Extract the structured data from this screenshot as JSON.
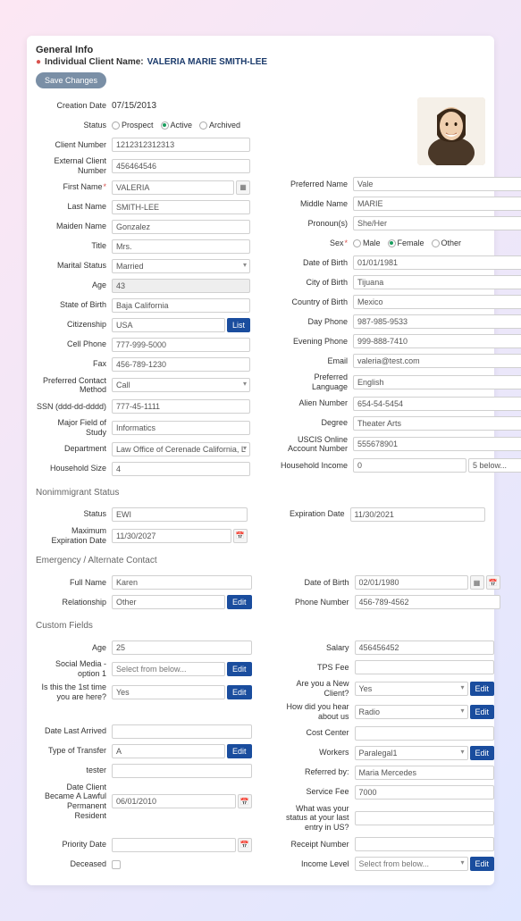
{
  "header": {
    "title": "General Info",
    "client_name_label": "Individual Client Name:",
    "client_name_value": "VALERIA MARIE SMITH-LEE",
    "save_btn": "Save Changes"
  },
  "radios": {
    "status": {
      "prospect": "Prospect",
      "active": "Active",
      "archived": "Archived"
    },
    "sex": {
      "male": "Male",
      "female": "Female",
      "other": "Other"
    }
  },
  "labels": {
    "creation_date": "Creation Date",
    "status": "Status",
    "client_number": "Client Number",
    "external_client_number": "External Client Number",
    "first_name": "First Name",
    "last_name": "Last Name",
    "maiden_name": "Maiden Name",
    "title": "Title",
    "marital_status": "Marital Status",
    "age": "Age",
    "state_of_birth": "State of Birth",
    "citizenship": "Citizenship",
    "cell_phone": "Cell Phone",
    "fax": "Fax",
    "preferred_contact_method": "Preferred Contact Method",
    "ssn": "SSN (ddd-dd-dddd)",
    "major_field": "Major Field of Study",
    "department": "Department",
    "household_size": "Household Size",
    "preferred_name": "Preferred Name",
    "middle_name": "Middle Name",
    "pronouns": "Pronoun(s)",
    "sex": "Sex",
    "date_of_birth": "Date of Birth",
    "city_of_birth": "City of Birth",
    "country_of_birth": "Country of Birth",
    "day_phone": "Day Phone",
    "evening_phone": "Evening Phone",
    "email": "Email",
    "preferred_language": "Preferred Language",
    "alien_number": "Alien Number",
    "degree": "Degree",
    "uscis_account": "USCIS Online Account Number",
    "household_income": "Household Income",
    "nonimmigrant_status": "Nonimmigrant Status",
    "ni_status": "Status",
    "expiration_date": "Expiration Date",
    "max_expiration_date": "Maximum Expiration Date",
    "emergency_contact": "Emergency / Alternate Contact",
    "full_name": "Full Name",
    "relationship": "Relationship",
    "phone_number": "Phone Number",
    "custom_fields": "Custom Fields",
    "cf_age": "Age",
    "salary": "Salary",
    "social_media": "Social Media - option 1",
    "tps_fee": "TPS Fee",
    "first_time": "Is this the 1st time you are here?",
    "new_client": "Are you a New Client?",
    "how_hear": "How did you hear about us",
    "date_last_arrived": "Date Last Arrived",
    "cost_center": "Cost Center",
    "type_transfer": "Type of Transfer",
    "workers": "Workers",
    "tester": "tester",
    "referred_by": "Referred by:",
    "date_lpr": "Date Client Became A Lawful Permanent Resident",
    "service_fee": "Service Fee",
    "status_last_entry": "What was your status at your last entry in US?",
    "priority_date": "Priority Date",
    "receipt_number": "Receipt Number",
    "deceased": "Deceased",
    "income_level": "Income Level"
  },
  "values": {
    "creation_date": "07/15/2013",
    "client_number": "1212312312313",
    "external_client_number": "456464546",
    "first_name": "VALERIA",
    "last_name": "SMITH-LEE",
    "maiden_name": "Gonzalez",
    "title": "Mrs.",
    "marital_status": "Married",
    "age": "43",
    "state_of_birth": "Baja California",
    "citizenship": "USA",
    "cell_phone": "777-999-5000",
    "fax": "456-789-1230",
    "preferred_contact_method": "Call",
    "ssn": "777-45-1111",
    "major_field": "Informatics",
    "department": "Law Office of Cerenade California, LLC (In",
    "household_size": "4",
    "preferred_name": "Vale",
    "middle_name": "MARIE",
    "pronouns": "She/Her",
    "date_of_birth": "01/01/1981",
    "city_of_birth": "Tijuana",
    "country_of_birth": "Mexico",
    "day_phone": "987-985-9533",
    "evening_phone": "999-888-7410",
    "email": "valeria@test.com",
    "preferred_language": "English",
    "alien_number": "654-54-5454",
    "degree": "Theater Arts",
    "uscis_account": "555678901",
    "household_income": "0",
    "household_income_range": "5 below...",
    "ni_status": "EWI",
    "expiration_date": "11/30/2021",
    "max_expiration_date": "11/30/2027",
    "ec_full_name": "Karen",
    "ec_relationship": "Other",
    "ec_dob": "02/01/1980",
    "ec_phone": "456-789-4562",
    "cf_age": "25",
    "salary": "456456452",
    "social_media_placeholder": "Select from below...",
    "first_time": "Yes",
    "new_client": "Yes",
    "how_hear": "Radio",
    "type_transfer": "A",
    "workers": "Paralegal1",
    "referred_by": "Maria Mercedes",
    "date_lpr": "06/01/2010",
    "service_fee": "7000",
    "income_level_placeholder": "Select from below..."
  },
  "buttons": {
    "list": "List",
    "edit": "Edit"
  }
}
